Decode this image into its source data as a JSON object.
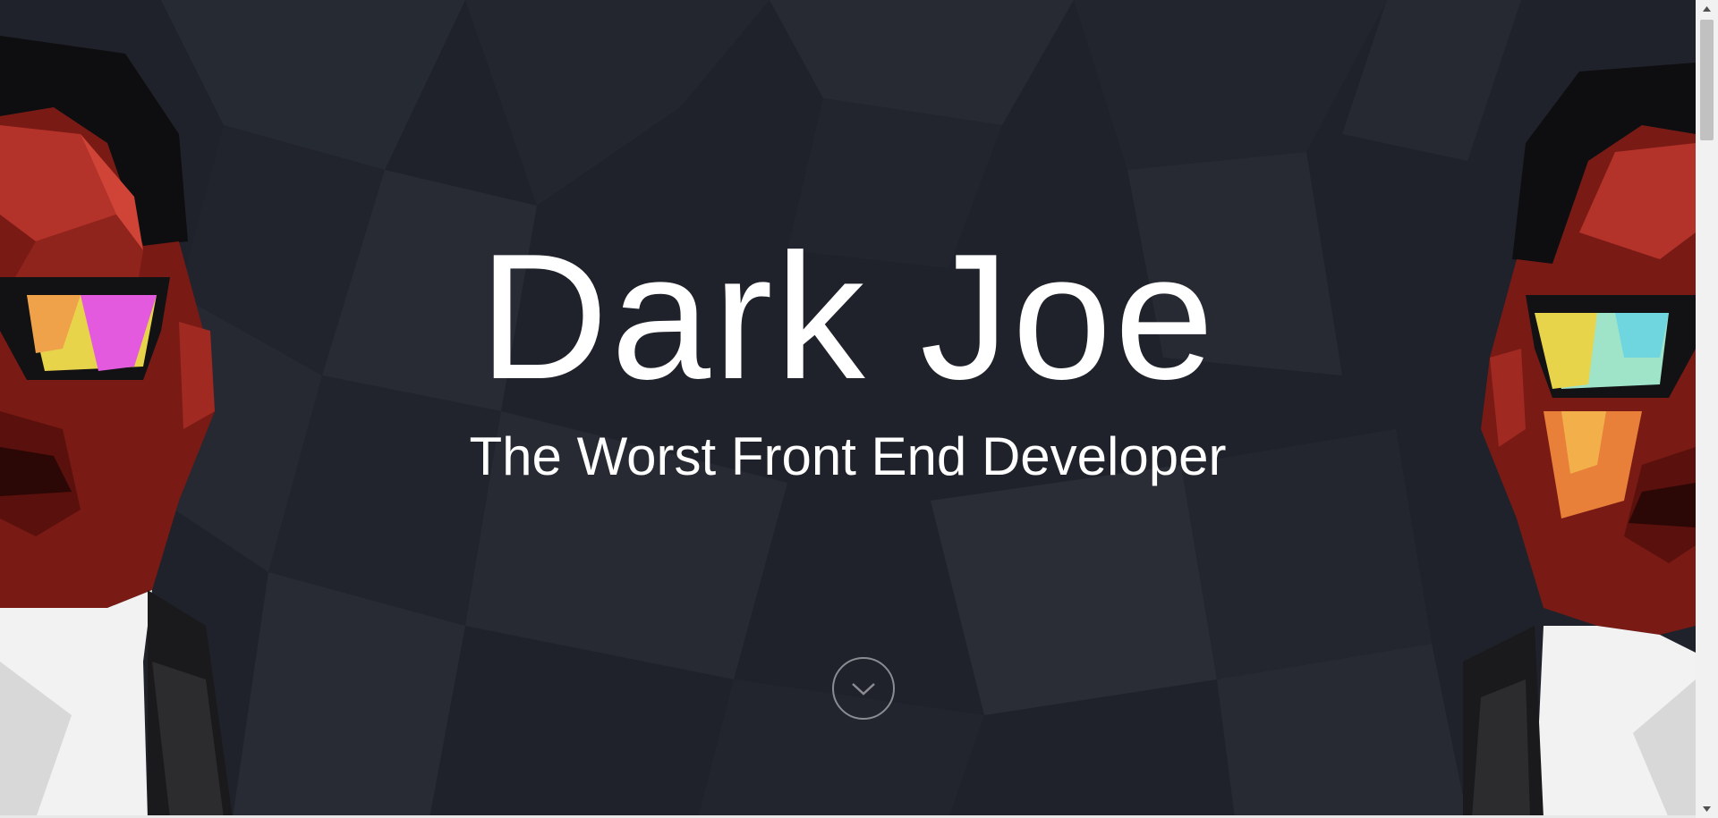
{
  "hero": {
    "title": "Dark Joe",
    "subtitle": "The Worst Front End Developer",
    "scroll_icon": "chevron-down-icon"
  },
  "colors": {
    "background": "#1f222b",
    "text": "#ffffff",
    "scroll_ring": "#8a8c92",
    "scrollbar_track": "#f1f1f1",
    "scrollbar_thumb": "#c1c1c1"
  },
  "illustrations": {
    "left": "low-poly-portrait-with-sunglasses",
    "right": "low-poly-portrait-with-sunglasses"
  }
}
